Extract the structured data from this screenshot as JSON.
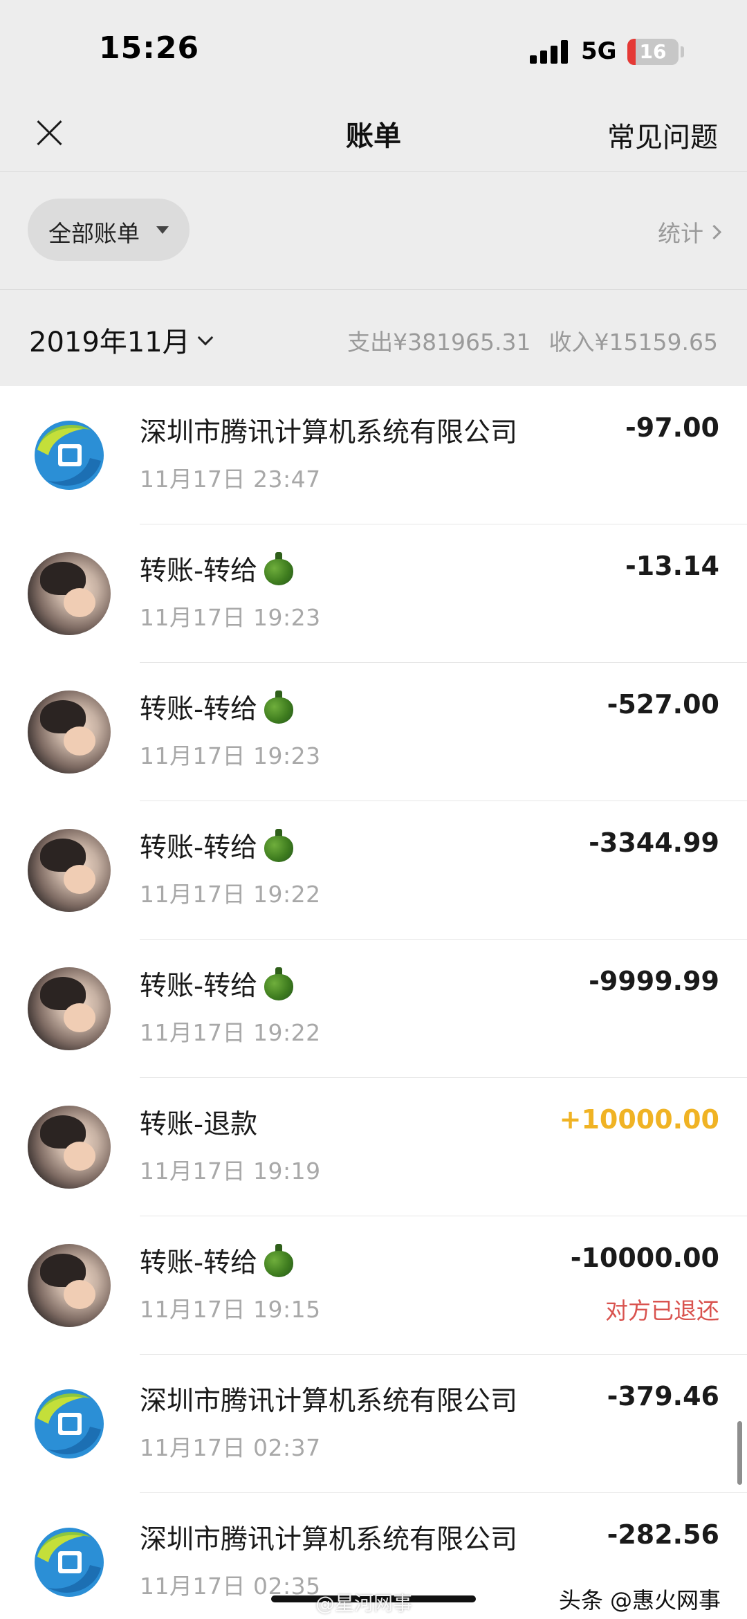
{
  "status_bar": {
    "time": "15:26",
    "network": "5G",
    "battery": "16",
    "battery_level": 0.16
  },
  "nav": {
    "title": "账单",
    "faq_label": "常见问题"
  },
  "filter": {
    "label": "全部账单",
    "stats_label": "统计"
  },
  "month": {
    "label": "2019年11月",
    "expense_summary": "支出¥381965.31",
    "income_summary": "收入¥15159.65"
  },
  "transactions": [
    {
      "title": "深圳市腾讯计算机系统有限公司",
      "time": "11月17日 23:47",
      "amount": "-97.00",
      "avatar": "tencent-logo"
    },
    {
      "title": "转账-转给",
      "time": "11月17日 19:23",
      "amount": "-13.14",
      "avatar": "user-photo",
      "emoji": "green-pepper"
    },
    {
      "title": "转账-转给",
      "time": "11月17日 19:23",
      "amount": "-527.00",
      "avatar": "user-photo",
      "emoji": "green-pepper"
    },
    {
      "title": "转账-转给",
      "time": "11月17日 19:22",
      "amount": "-3344.99",
      "avatar": "user-photo",
      "emoji": "green-pepper"
    },
    {
      "title": "转账-转给",
      "time": "11月17日 19:22",
      "amount": "-9999.99",
      "avatar": "user-photo",
      "emoji": "green-pepper"
    },
    {
      "title": "转账-退款",
      "time": "11月17日 19:19",
      "amount": "+10000.00",
      "avatar": "user-photo",
      "income": true
    },
    {
      "title": "转账-转给",
      "time": "11月17日 19:15",
      "amount": "-10000.00",
      "note": "对方已退还",
      "avatar": "user-photo",
      "emoji": "green-pepper"
    },
    {
      "title": "深圳市腾讯计算机系统有限公司",
      "time": "11月17日 02:37",
      "amount": "-379.46",
      "avatar": "tencent-logo"
    },
    {
      "title": "深圳市腾讯计算机系统有限公司",
      "time": "11月17日 02:35",
      "amount": "-282.56",
      "avatar": "tencent-logo"
    }
  ],
  "watermarks": {
    "center": "@星河网事",
    "right": "头条 @惠火网事"
  },
  "colors": {
    "income": "#f0b324",
    "refund_note": "#d9534f",
    "header_bg": "#ededed",
    "list_bg": "#ffffff"
  }
}
